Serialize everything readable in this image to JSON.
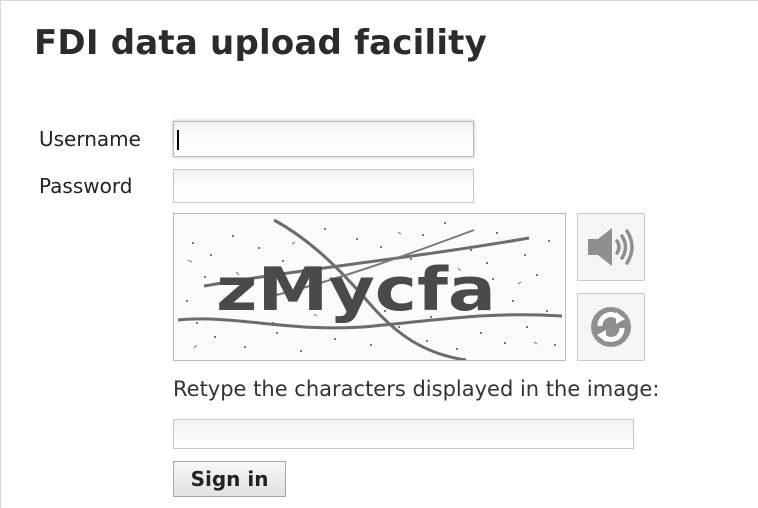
{
  "page": {
    "title": "FDI data upload facility"
  },
  "form": {
    "username_label": "Username",
    "username_value": "",
    "password_label": "Password",
    "password_value": "",
    "captcha": {
      "image_text": "zMycfa",
      "audio_icon": "speaker-icon",
      "refresh_icon": "refresh-icon",
      "instruction": "Retype the characters displayed in the image:",
      "value": ""
    },
    "signin_label": "Sign in"
  },
  "colors": {
    "title": "#2b2b2b",
    "icon_gray": "#8f8f8f",
    "captcha_text": "#4a4a4a",
    "input_border": "#c7c7c7"
  }
}
